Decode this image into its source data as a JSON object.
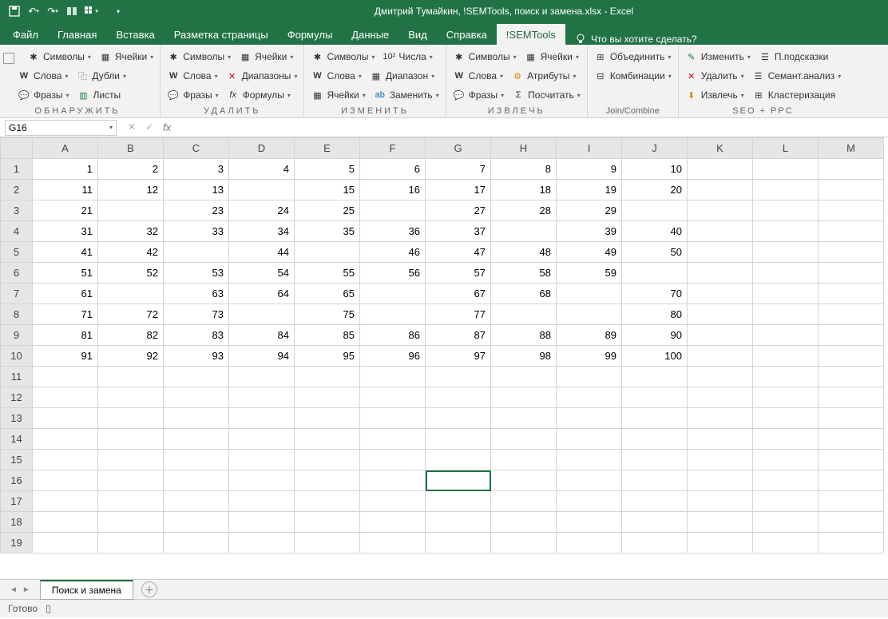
{
  "title": "Дмитрий Тумайкин, !SEMTools, поиск и замена.xlsx  -  Excel",
  "tabs": [
    "Файл",
    "Главная",
    "Вставка",
    "Разметка страницы",
    "Формулы",
    "Данные",
    "Вид",
    "Справка",
    "!SEMTools"
  ],
  "active_tab": "!SEMTools",
  "tell_me": "Что вы хотите сделать?",
  "ribbon": {
    "g1": {
      "label": "ОБНАРУЖИТЬ",
      "r1a": "Символы",
      "r1b": "Ячейки",
      "r2a": "Слова",
      "r2b": "Дубли",
      "r3a": "Фразы",
      "r3b": "Листы"
    },
    "g2": {
      "label": "УДАЛИТЬ",
      "r1a": "Символы",
      "r1b": "Ячейки",
      "r2a": "Слова",
      "r2b": "Диапазоны",
      "r3a": "Фразы",
      "r3b": "Формулы"
    },
    "g3": {
      "label": "ИЗМЕНИТЬ",
      "r1a": "Символы",
      "r1b": "Числа",
      "r2a": "Слова",
      "r2b": "Диапазон",
      "r3a": "Ячейки",
      "r3b": "Заменить"
    },
    "g4": {
      "label": "ИЗВЛЕЧЬ",
      "r1a": "Символы",
      "r1b": "Ячейки",
      "r2a": "Слова",
      "r2b": "Атрибуты",
      "r3a": "Фразы",
      "r3b": "Посчитать"
    },
    "g5": {
      "label": "Join/Combine",
      "r1": "Объединить",
      "r2": "Комбинации"
    },
    "g6": {
      "label": "SEO + PPC",
      "r1a": "Изменить",
      "r1b": "П.подсказки",
      "r2a": "Удалить",
      "r2b": "Семант.анализ",
      "r3a": "Извлечь",
      "r3b": "Кластеризация"
    }
  },
  "namebox": "G16",
  "columns": [
    "A",
    "B",
    "C",
    "D",
    "E",
    "F",
    "G",
    "H",
    "I",
    "J",
    "K",
    "L",
    "M"
  ],
  "rows": 19,
  "data": {
    "1": {
      "A": "1",
      "B": "2",
      "C": "3",
      "D": "4",
      "E": "5",
      "F": "6",
      "G": "7",
      "H": "8",
      "I": "9",
      "J": "10"
    },
    "2": {
      "A": "11",
      "B": "12",
      "C": "13",
      "E": "15",
      "F": "16",
      "G": "17",
      "H": "18",
      "I": "19",
      "J": "20"
    },
    "3": {
      "A": "21",
      "C": "23",
      "D": "24",
      "E": "25",
      "G": "27",
      "H": "28",
      "I": "29"
    },
    "4": {
      "A": "31",
      "B": "32",
      "C": "33",
      "D": "34",
      "E": "35",
      "F": "36",
      "G": "37",
      "I": "39",
      "J": "40"
    },
    "5": {
      "A": "41",
      "B": "42",
      "D": "44",
      "F": "46",
      "G": "47",
      "H": "48",
      "I": "49",
      "J": "50"
    },
    "6": {
      "A": "51",
      "B": "52",
      "C": "53",
      "D": "54",
      "E": "55",
      "F": "56",
      "G": "57",
      "H": "58",
      "I": "59"
    },
    "7": {
      "A": "61",
      "C": "63",
      "D": "64",
      "E": "65",
      "G": "67",
      "H": "68",
      "J": "70"
    },
    "8": {
      "A": "71",
      "B": "72",
      "C": "73",
      "E": "75",
      "G": "77",
      "J": "80"
    },
    "9": {
      "A": "81",
      "B": "82",
      "C": "83",
      "D": "84",
      "E": "85",
      "F": "86",
      "G": "87",
      "H": "88",
      "I": "89",
      "J": "90"
    },
    "10": {
      "A": "91",
      "B": "92",
      "C": "93",
      "D": "94",
      "E": "95",
      "F": "96",
      "G": "97",
      "H": "98",
      "I": "99",
      "J": "100"
    }
  },
  "selected_cell": {
    "row": 16,
    "col": "G"
  },
  "sheet_tab": "Поиск и замена",
  "status": "Готово"
}
